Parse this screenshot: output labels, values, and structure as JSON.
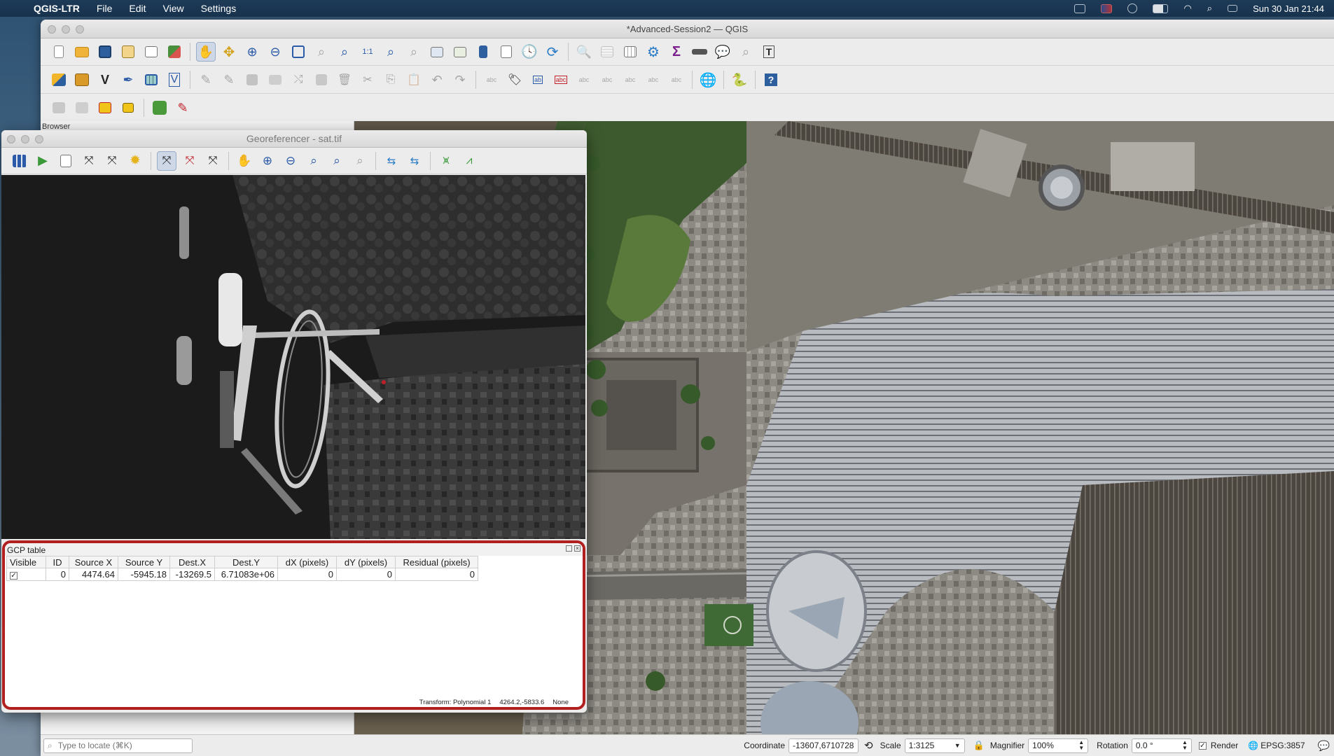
{
  "menubar": {
    "app_name": "QGIS-LTR",
    "items": [
      "File",
      "Edit",
      "View",
      "Settings"
    ],
    "clock": "Sun 30 Jan  21:44"
  },
  "main_window": {
    "title": "*Advanced-Session2 — QGIS",
    "browser_dock_title": "Browser"
  },
  "georeferencer": {
    "title": "Georeferencer - sat.tif",
    "gcp_table": {
      "title": "GCP table",
      "columns": [
        "Visible",
        "ID",
        "Source X",
        "Source Y",
        "Dest.X",
        "Dest.Y",
        "dX (pixels)",
        "dY (pixels)",
        "Residual (pixels)"
      ],
      "rows": [
        {
          "visible": "✓",
          "id": "0",
          "source_x": "4474.64",
          "source_y": "-5945.18",
          "dest_x": "-13269.5",
          "dest_y": "6.71083e+06",
          "dx": "0",
          "dy": "0",
          "residual": "0"
        }
      ]
    },
    "status": {
      "transform": "Transform: Polynomial 1",
      "coords": "4264.2,-5833.6",
      "crs": "None"
    }
  },
  "statusbar": {
    "search_placeholder": "Type to locate (⌘K)",
    "coordinate_label": "Coordinate",
    "coordinate_value": "-13607,6710728",
    "scale_label": "Scale",
    "scale_value": "1:3125",
    "magnifier_label": "Magnifier",
    "magnifier_value": "100%",
    "rotation_label": "Rotation",
    "rotation_value": "0.0 °",
    "render_label": "Render",
    "crs_label": "EPSG:3857"
  },
  "colors": {
    "accent_red": "#b21f1f",
    "menubar": "#17324d",
    "gcp_point": "#c0202a"
  }
}
